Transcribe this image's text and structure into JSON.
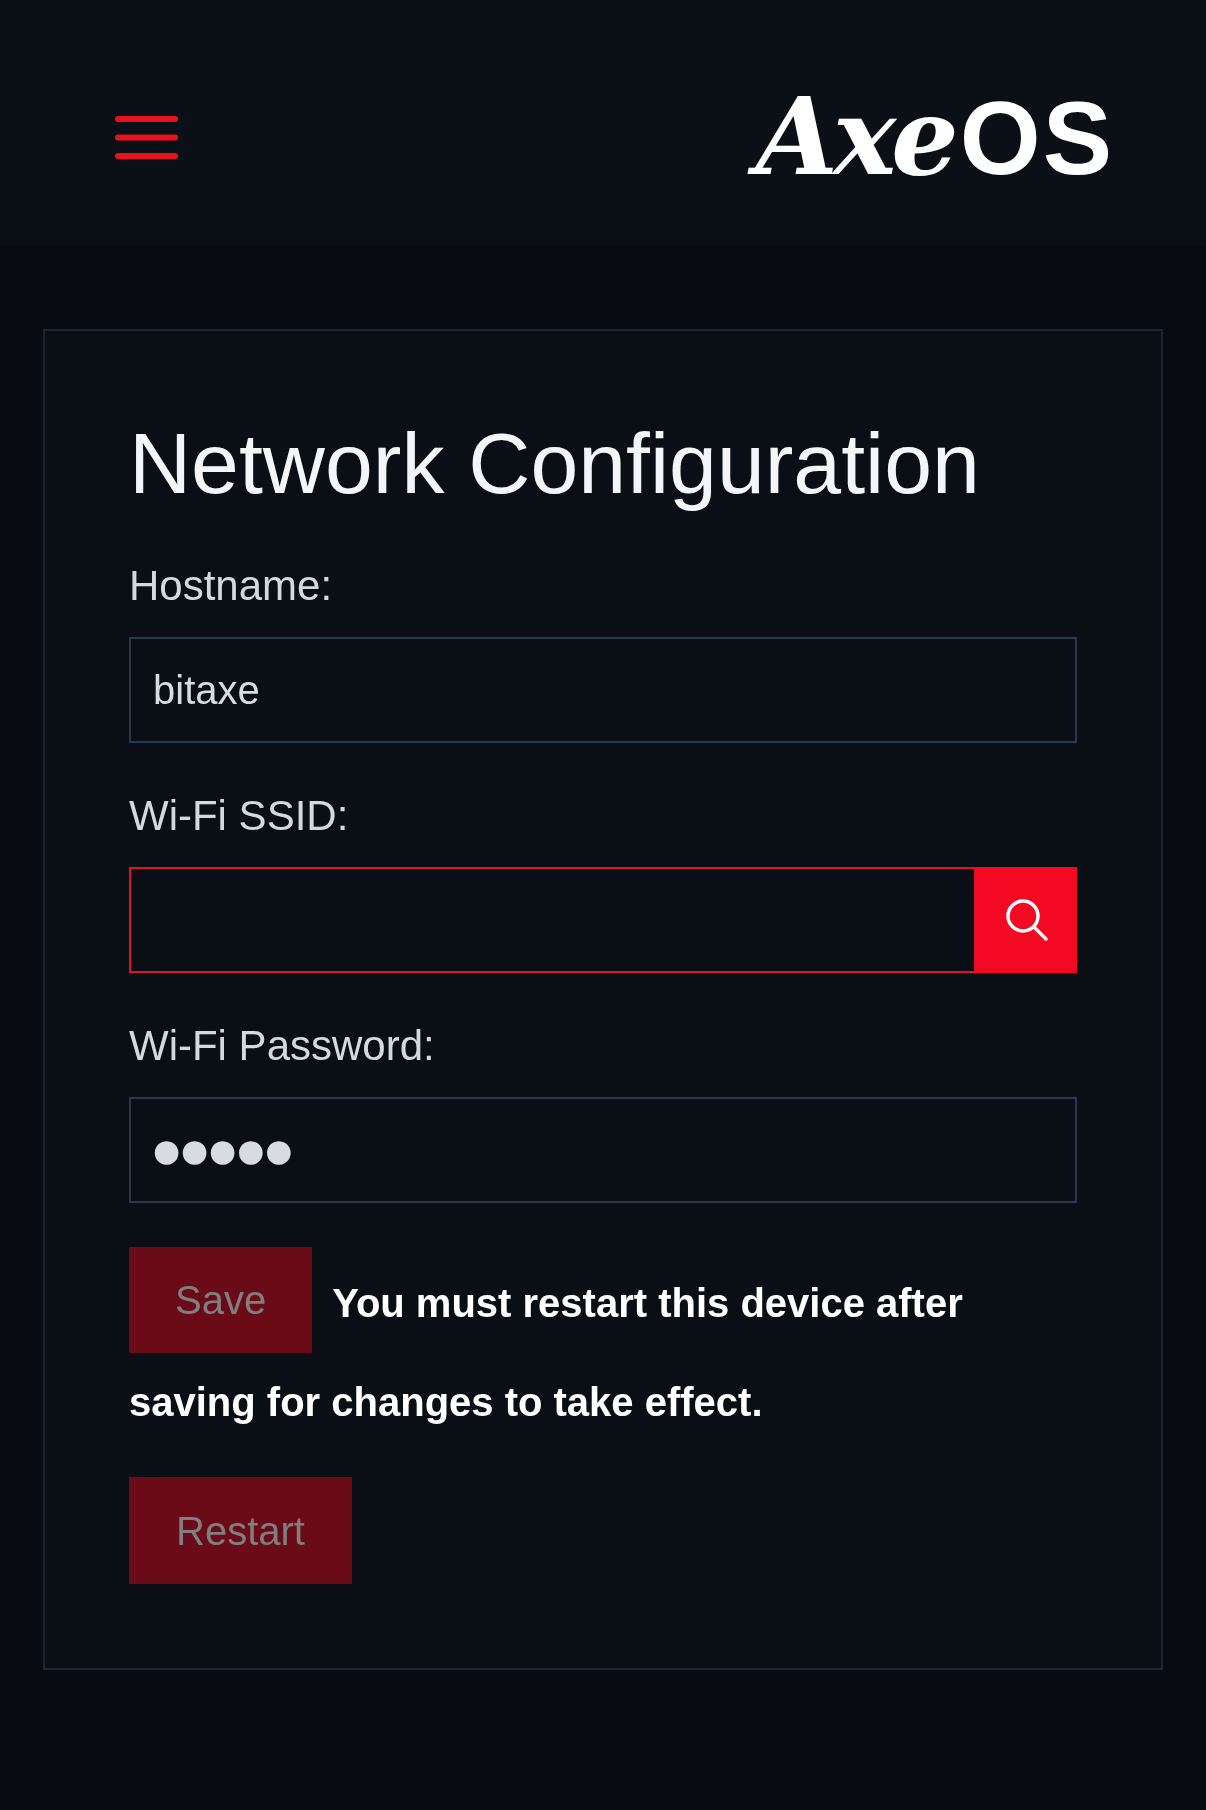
{
  "header": {
    "logo": {
      "script": "Axe",
      "block": "OS"
    }
  },
  "form": {
    "title": "Network Configuration",
    "fields": [
      {
        "kind": "text",
        "label": "Hostname:",
        "value": "bitaxe",
        "invalid": false
      },
      {
        "kind": "search",
        "label": "Wi-Fi SSID:",
        "invalid": true
      },
      {
        "kind": "password",
        "label": "Wi-Fi Password:",
        "value": "●●●●●",
        "invalid": false
      }
    ],
    "save_button": {
      "label": "Save",
      "disabled": true
    },
    "notice_lines": [
      "You must restart this device after",
      "saving for changes to take effect."
    ],
    "restart_button": {
      "label": "Restart",
      "disabled": true
    }
  }
}
